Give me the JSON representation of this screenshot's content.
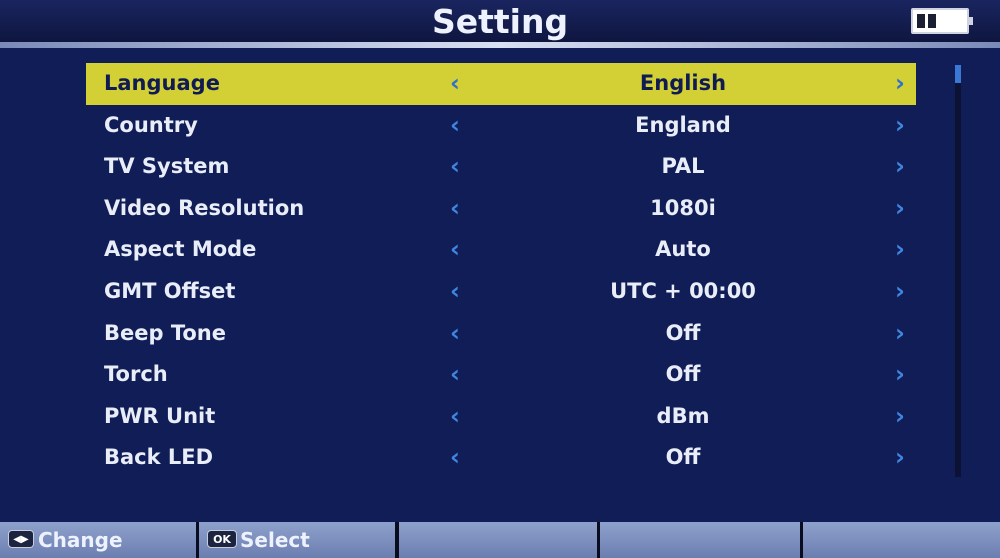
{
  "header": {
    "title": "Setting",
    "battery_icon": "battery-icon"
  },
  "colors": {
    "background": "#101d56",
    "selected_row": "#d2d035",
    "arrow": "#3f86e0",
    "text": "#e9edf8"
  },
  "menu": {
    "selected_index": 0,
    "items": [
      {
        "label": "Language",
        "value": "English"
      },
      {
        "label": "Country",
        "value": "England"
      },
      {
        "label": "TV System",
        "value": "PAL"
      },
      {
        "label": "Video Resolution",
        "value": "1080i"
      },
      {
        "label": "Aspect Mode",
        "value": "Auto"
      },
      {
        "label": "GMT Offset",
        "value": "UTC + 00:00"
      },
      {
        "label": "Beep Tone",
        "value": "Off"
      },
      {
        "label": "Torch",
        "value": "Off"
      },
      {
        "label": "PWR Unit",
        "value": "dBm"
      },
      {
        "label": "Back LED",
        "value": "Off"
      }
    ],
    "arrow_left": "‹",
    "arrow_right": "›"
  },
  "footer": {
    "change_key": "◀▶",
    "change_label": "Change",
    "select_key": "OK",
    "select_label": "Select"
  }
}
